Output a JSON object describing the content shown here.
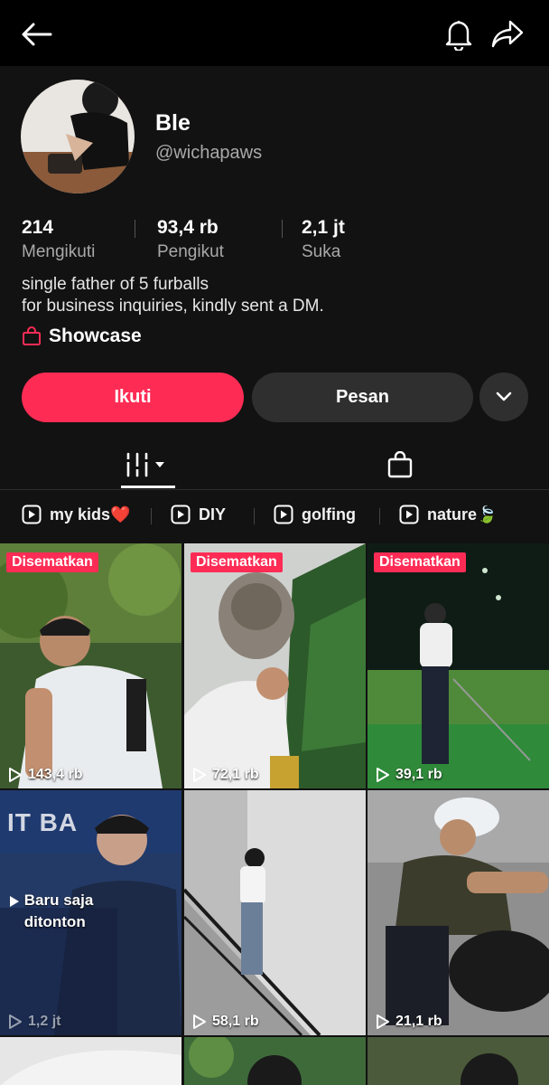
{
  "header": {
    "back_icon": "arrow-left-icon",
    "bell_icon": "bell-icon",
    "share_icon": "share-icon"
  },
  "profile": {
    "name": "Ble",
    "handle": "@wichapaws",
    "stats": [
      {
        "value": "214",
        "label": "Mengikuti"
      },
      {
        "value": "93,4 rb",
        "label": "Pengikut"
      },
      {
        "value": "2,1 jt",
        "label": "Suka"
      }
    ],
    "bio_line1": "single father of 5 furballs",
    "bio_line2": "for business inquiries, kindly sent a DM.",
    "showcase_label": "Showcase"
  },
  "actions": {
    "follow_label": "Ikuti",
    "message_label": "Pesan"
  },
  "playlists": [
    {
      "label": "my kids",
      "emoji": "❤️"
    },
    {
      "label": "DIY",
      "emoji": ""
    },
    {
      "label": "golfing",
      "emoji": ""
    },
    {
      "label": "nature",
      "emoji": "🍃"
    }
  ],
  "videos": [
    {
      "pinned": "Disematkan",
      "views": "143,4 rb"
    },
    {
      "pinned": "Disematkan",
      "views": "72,1 rb"
    },
    {
      "pinned": "Disematkan",
      "views": "39,1 rb"
    },
    {
      "watched": "Baru saja ditonton",
      "views": "1,2 jt",
      "banner": "IT BA"
    },
    {
      "views": "58,1 rb"
    },
    {
      "views": "21,1 rb"
    }
  ],
  "colors": {
    "accent": "#fe2c55",
    "background": "#121212",
    "topbar": "#000000",
    "secondary_button": "#2f2f2f"
  }
}
